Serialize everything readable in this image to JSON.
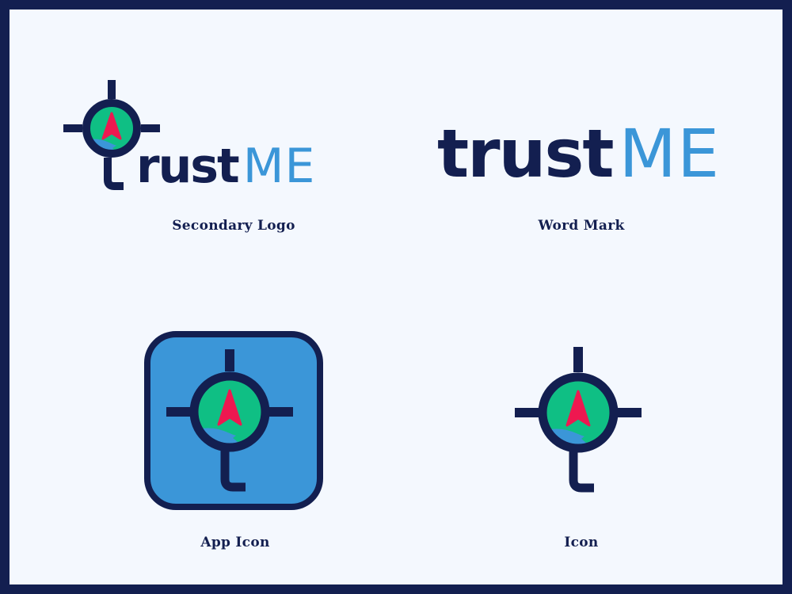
{
  "colors": {
    "navy": "#131f50",
    "blue": "#3b96d8",
    "green": "#0fbf84",
    "red": "#ee1850",
    "background": "#f4f8fe"
  },
  "icons": {
    "compass": "crosshair-compass-icon",
    "arrow": "arrow-up-icon"
  },
  "panels": [
    {
      "title": "Secondary Logo",
      "wordmark": {
        "dark": "rust",
        "blue": "ME"
      }
    },
    {
      "title": "Word Mark",
      "wordmark": {
        "dark": "trust",
        "blue": "ME"
      }
    },
    {
      "title": "App Icon"
    },
    {
      "title": "Icon"
    }
  ]
}
